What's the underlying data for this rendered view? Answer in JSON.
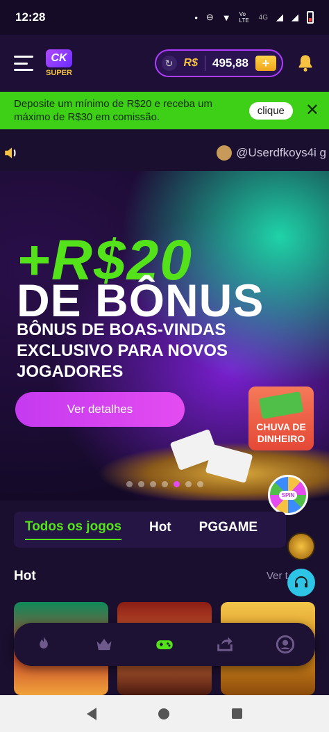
{
  "status_bar": {
    "time": "12:28",
    "net_label": "Vo LTE",
    "net_type": "4G"
  },
  "header": {
    "logo_mark": "CK",
    "logo_text": "SUPER",
    "currency": "R$",
    "balance": "495,88",
    "deposit_symbol": "+"
  },
  "promo": {
    "text": "Deposite um mínimo de R$20 e receba um máximo de R$30 em comissão.",
    "button": "clique",
    "close": "✕"
  },
  "marquee": {
    "text": "@Userdfkoys4i g"
  },
  "hero": {
    "amount": "+R$20",
    "title": "DE BÔNUS",
    "subtitle": "BÔNUS DE BOAS-VINDAS EXCLUSIVO PARA NOVOS JOGADORES",
    "button": "Ver detalhes",
    "slide_count": 7,
    "active_slide": 5
  },
  "rain_badge": {
    "label": "CHUVA DE DINHEIRO"
  },
  "spin": {
    "label": "SPIN"
  },
  "tabs": [
    {
      "label": "Todos os jogos",
      "active": true
    },
    {
      "label": "Hot",
      "active": false
    },
    {
      "label": "PGGAME",
      "active": false
    }
  ],
  "section": {
    "title": "Hot",
    "see_all": "Ver t"
  },
  "colors": {
    "accent_green": "#54e31a",
    "accent_purple": "#c53af0",
    "background": "#1a0f2e"
  }
}
